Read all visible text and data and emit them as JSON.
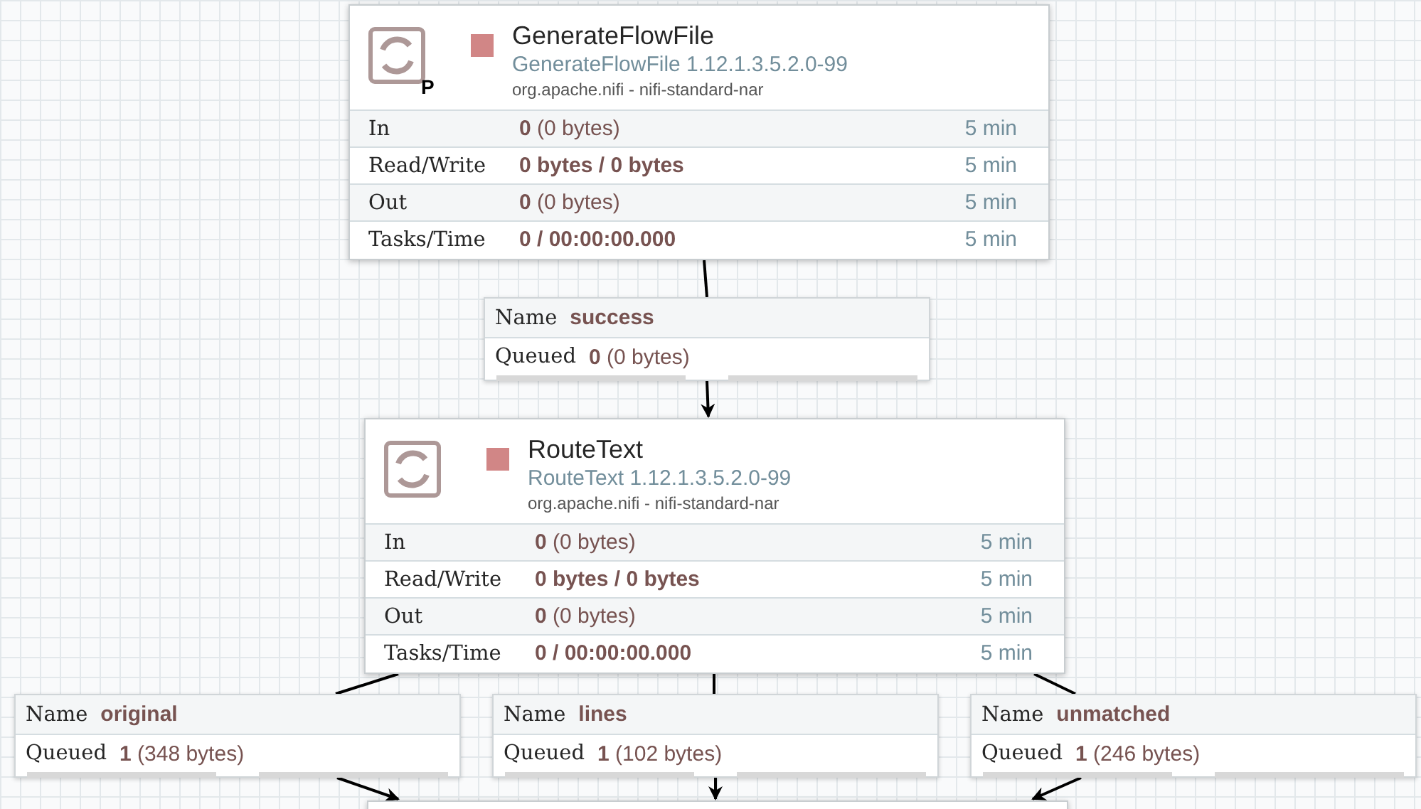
{
  "processors": [
    {
      "name": "GenerateFlowFile",
      "type": "GenerateFlowFile 1.12.1.3.5.2.0-99",
      "bundle": "org.apache.nifi - nifi-standard-nar",
      "stopped": true,
      "primary_badge": "P",
      "stats": [
        {
          "label": "In",
          "value": "**0** (0 bytes)",
          "window": "5 min"
        },
        {
          "label": "Read/Write",
          "value": "**0 bytes / 0 bytes**",
          "window": "5 min"
        },
        {
          "label": "Out",
          "value": "**0** (0 bytes)",
          "window": "5 min"
        },
        {
          "label": "Tasks/Time",
          "value": "**0 / 00:00:00.000**",
          "window": "5 min"
        }
      ]
    },
    {
      "name": "RouteText",
      "type": "RouteText 1.12.1.3.5.2.0-99",
      "bundle": "org.apache.nifi - nifi-standard-nar",
      "stopped": true,
      "stats": [
        {
          "label": "In",
          "value": "**0** (0 bytes)",
          "window": "5 min"
        },
        {
          "label": "Read/Write",
          "value": "**0 bytes / 0 bytes**",
          "window": "5 min"
        },
        {
          "label": "Out",
          "value": "**0** (0 bytes)",
          "window": "5 min"
        },
        {
          "label": "Tasks/Time",
          "value": "**0 / 00:00:00.000**",
          "window": "5 min"
        }
      ]
    },
    {
      "kind": "partial"
    }
  ],
  "connections": [
    {
      "name_label": "Name",
      "name": "success",
      "queued_label": "Queued",
      "queued": "**0** (0 bytes)"
    },
    {
      "name_label": "Name",
      "name": "original",
      "queued_label": "Queued",
      "queued": "**1** (348 bytes)"
    },
    {
      "name_label": "Name",
      "name": "lines",
      "queued_label": "Queued",
      "queued": "**1** (102 bytes)"
    },
    {
      "name_label": "Name",
      "name": "unmatched",
      "queued_label": "Queued",
      "queued": "**1** (246 bytes)"
    }
  ]
}
